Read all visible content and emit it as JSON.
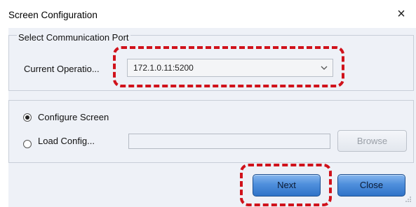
{
  "window": {
    "title": "Screen Configuration",
    "close_glyph": "×"
  },
  "port_group": {
    "title": "Select Communication Port",
    "current_label": "Current Operatio...",
    "current_value": "172.1.0.11:5200"
  },
  "config_group": {
    "configure_label": "Configure Screen",
    "configure_selected": true,
    "load_label": "Load Config...",
    "load_path": "",
    "browse_label": "Browse"
  },
  "buttons": {
    "next_label": "Next",
    "close_label": "Close"
  },
  "icons": {
    "close": "close-icon",
    "dropdown": "chevron-down-icon",
    "resize": "resize-grip-icon"
  },
  "colors": {
    "highlight": "#d0121b",
    "button_blue": "#4f8fdc",
    "panel_background": "#eef1f7"
  }
}
